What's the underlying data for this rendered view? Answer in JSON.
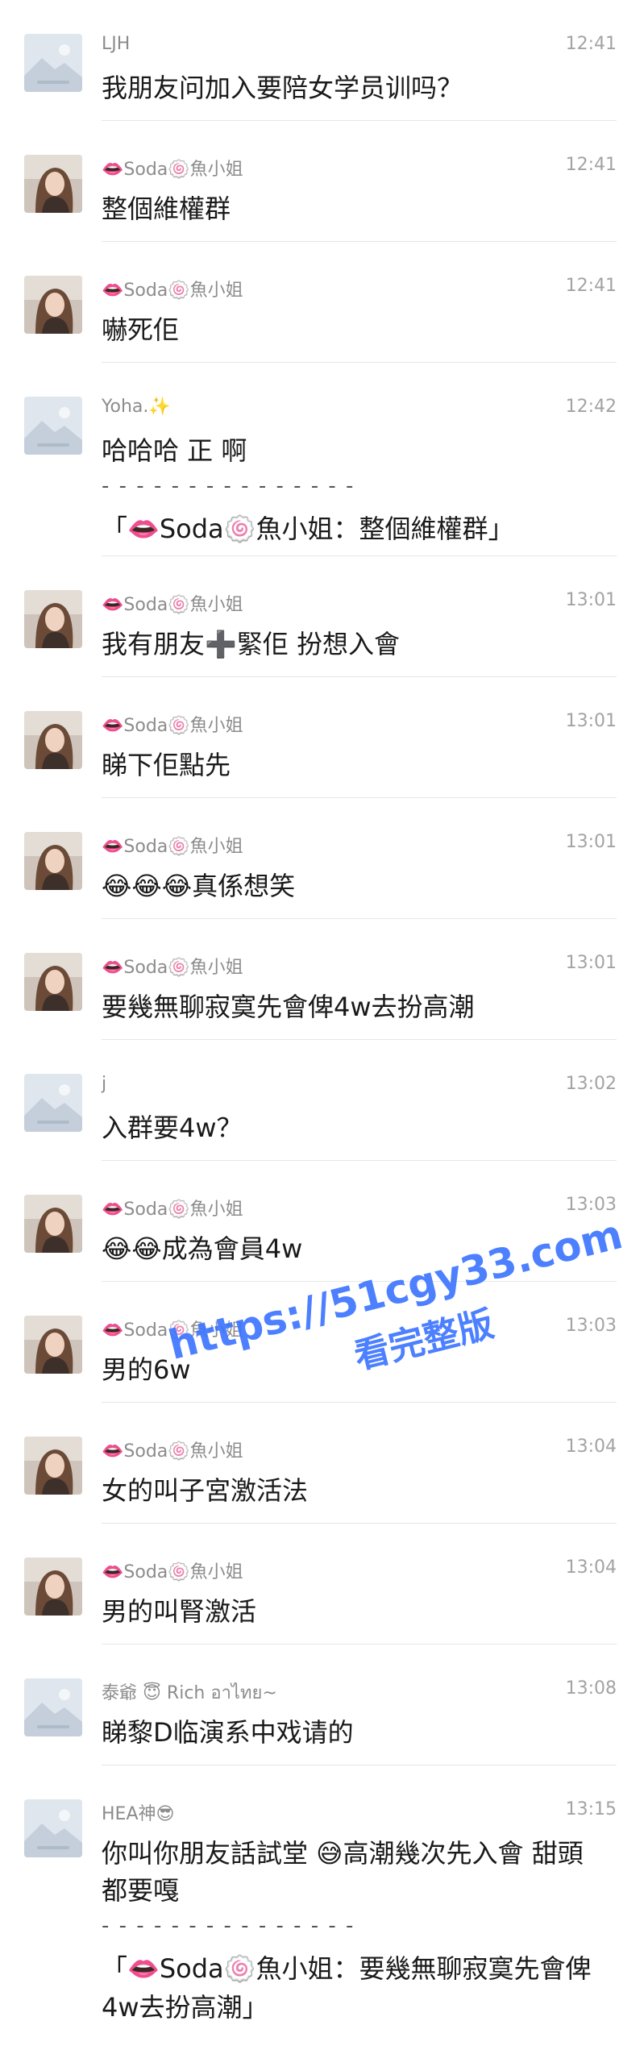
{
  "messages": [
    {
      "name": "LJH",
      "time": "12:41",
      "avatar": "default",
      "text": "我朋友问加入要陪女学员训吗？"
    },
    {
      "name": "👄Soda🍥魚小姐",
      "time": "12:41",
      "avatar": "photo",
      "text": "整個維權群"
    },
    {
      "name": "👄Soda🍥魚小姐",
      "time": "12:41",
      "avatar": "photo",
      "text": "嚇死佢"
    },
    {
      "name": "Yoha.✨",
      "time": "12:42",
      "avatar": "default",
      "text": "哈哈哈 正 啊",
      "quote": {
        "line": "- - - - - - - - - - - - - - -",
        "text": "「👄Soda🍥魚小姐：整個維權群」"
      }
    },
    {
      "name": "👄Soda🍥魚小姐",
      "time": "13:01",
      "avatar": "photo",
      "text": "我有朋友➕緊佢 扮想入會"
    },
    {
      "name": "👄Soda🍥魚小姐",
      "time": "13:01",
      "avatar": "photo",
      "text": "睇下佢點先"
    },
    {
      "name": "👄Soda🍥魚小姐",
      "time": "13:01",
      "avatar": "photo",
      "text": "😂😂😂真係想笑"
    },
    {
      "name": "👄Soda🍥魚小姐",
      "time": "13:01",
      "avatar": "photo",
      "text": "要幾無聊寂寞先會俾4w去扮高潮"
    },
    {
      "name": "j",
      "time": "13:02",
      "avatar": "default",
      "text": "入群要4w？"
    },
    {
      "name": "👄Soda🍥魚小姐",
      "time": "13:03",
      "avatar": "photo",
      "text": "😂😂成為會員4w"
    },
    {
      "name": "👄Soda🍥魚小姐",
      "time": "13:03",
      "avatar": "photo",
      "text": "男的6w"
    },
    {
      "name": "👄Soda🍥魚小姐",
      "time": "13:04",
      "avatar": "photo",
      "text": "女的叫子宮激活法"
    },
    {
      "name": "👄Soda🍥魚小姐",
      "time": "13:04",
      "avatar": "photo",
      "text": "男的叫腎激活"
    },
    {
      "name": "泰爺 😇 Rich อาไทย~",
      "time": "13:08",
      "avatar": "default",
      "text": "睇黎D临演系中戏请的"
    },
    {
      "name": "HEA神😎",
      "time": "13:15",
      "avatar": "default",
      "text": "你叫你朋友話試堂 😅高潮幾次先入會 甜頭都要嘎",
      "quote": {
        "line": "- - - - - - - - - - - - - - -",
        "text": "「👄Soda🍥魚小姐：要幾無聊寂寞先會俾4w去扮高潮」"
      }
    }
  ],
  "watermark": {
    "url": "https://51cgy33.com",
    "subtitle": "看完整版"
  },
  "colors": {
    "name": "#8c8c8c",
    "time": "#a3a3a3",
    "text": "#1a1a1a",
    "watermark": "#3a73ff"
  }
}
